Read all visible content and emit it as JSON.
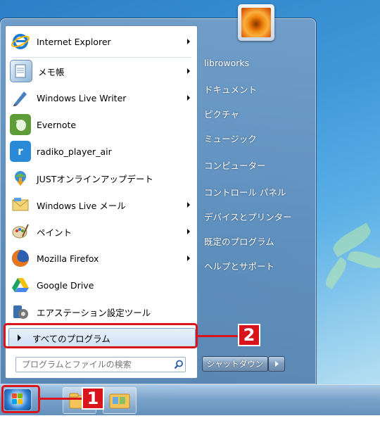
{
  "start_menu": {
    "programs": [
      {
        "label": "Internet Explorer",
        "icon": "internet-explorer-icon",
        "has_submenu": true
      },
      {
        "label": "メモ帳",
        "icon": "notepad-icon",
        "has_submenu": true
      },
      {
        "label": "Windows Live Writer",
        "icon": "live-writer-icon",
        "has_submenu": true
      },
      {
        "label": "Evernote",
        "icon": "evernote-icon",
        "has_submenu": false
      },
      {
        "label": "radiko_player_air",
        "icon": "radiko-icon",
        "has_submenu": false
      },
      {
        "label": "JUSTオンラインアップデート",
        "icon": "just-update-icon",
        "has_submenu": false
      },
      {
        "label": "Windows Live メール",
        "icon": "live-mail-icon",
        "has_submenu": true
      },
      {
        "label": "ペイント",
        "icon": "paint-icon",
        "has_submenu": true
      },
      {
        "label": "Mozilla Firefox",
        "icon": "firefox-icon",
        "has_submenu": true
      },
      {
        "label": "Google Drive",
        "icon": "google-drive-icon",
        "has_submenu": false
      },
      {
        "label": "エアステーション設定ツール",
        "icon": "airstation-tool-icon",
        "has_submenu": false
      }
    ],
    "all_programs_label": "すべてのプログラム",
    "search_placeholder": "プログラムとファイルの検索",
    "right_links": [
      "libroworks",
      "ドキュメント",
      "ピクチャ",
      "ミュージック",
      "コンピューター",
      "コントロール パネル",
      "デバイスとプリンター",
      "既定のプログラム",
      "ヘルプとサポート"
    ],
    "shutdown_label": "シャットダウン"
  },
  "callouts": {
    "one": "1",
    "two": "2"
  },
  "colors": {
    "callout": "#d8141c",
    "taskbar": "#7fa7cf",
    "menu_glass": "#6f99c4"
  }
}
